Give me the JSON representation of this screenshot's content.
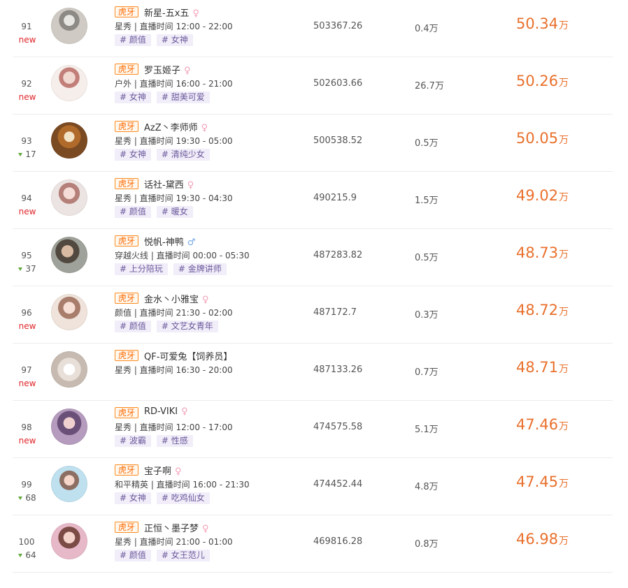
{
  "colors": {
    "platform_tag": "#ff6a00",
    "heat": "#e9702c",
    "new_badge": "#e0262a",
    "down_arrow": "#62a83a",
    "tag_bg": "#f1edf9",
    "tag_text": "#6b5a9c",
    "female_icon": "#f29fb6",
    "male_icon": "#73a8e6"
  },
  "rows": [
    {
      "rank": "91",
      "change": "new",
      "change_type": "new",
      "platform": "虎牙",
      "name": "新星-五x五",
      "gender": "female",
      "category": "星秀",
      "schedule": "星秀 | 直播时间 12:00 - 22:00",
      "tags": [
        "# 颜值",
        "# 女神"
      ],
      "score": "503367.26",
      "fans": "0.4万",
      "heat": "50.34",
      "heat_unit": "万"
    },
    {
      "rank": "92",
      "change": "new",
      "change_type": "new",
      "platform": "虎牙",
      "name": "罗玉姬子",
      "gender": "female",
      "schedule": "户外 | 直播时间 16:00 - 21:00",
      "tags": [
        "# 女神",
        "# 甜美可爱"
      ],
      "score": "502603.66",
      "fans": "26.7万",
      "heat": "50.26",
      "heat_unit": "万"
    },
    {
      "rank": "93",
      "change": "17",
      "change_type": "down",
      "platform": "虎牙",
      "name": "AzZ丶李师师",
      "gender": "female",
      "schedule": "星秀 | 直播时间 19:30 - 05:00",
      "tags": [
        "# 女神",
        "# 清纯少女"
      ],
      "score": "500538.52",
      "fans": "0.5万",
      "heat": "50.05",
      "heat_unit": "万"
    },
    {
      "rank": "94",
      "change": "new",
      "change_type": "new",
      "platform": "虎牙",
      "name": "话社-黛西",
      "gender": "female",
      "schedule": "星秀 | 直播时间 19:30 - 04:30",
      "tags": [
        "# 颜值",
        "# 暖女"
      ],
      "score": "490215.9",
      "fans": "1.5万",
      "heat": "49.02",
      "heat_unit": "万"
    },
    {
      "rank": "95",
      "change": "37",
      "change_type": "down",
      "platform": "虎牙",
      "name": "悦帆-神鸭",
      "gender": "male",
      "schedule": "穿越火线 | 直播时间 00:00 - 05:30",
      "tags": [
        "# 上分陪玩",
        "# 金牌讲师"
      ],
      "score": "487283.82",
      "fans": "0.5万",
      "heat": "48.73",
      "heat_unit": "万"
    },
    {
      "rank": "96",
      "change": "new",
      "change_type": "new",
      "platform": "虎牙",
      "name": "金水丶小雅宝",
      "gender": "female",
      "schedule": "颜值 | 直播时间 21:30 - 02:00",
      "tags": [
        "# 颜值",
        "# 文艺女青年"
      ],
      "score": "487172.7",
      "fans": "0.3万",
      "heat": "48.72",
      "heat_unit": "万"
    },
    {
      "rank": "97",
      "change": "new",
      "change_type": "new",
      "platform": "虎牙",
      "name": "QF-可爱兔【饲养员】",
      "gender": "",
      "schedule": "星秀 | 直播时间 16:30 - 20:00",
      "tags": [],
      "score": "487133.26",
      "fans": "0.7万",
      "heat": "48.71",
      "heat_unit": "万"
    },
    {
      "rank": "98",
      "change": "new",
      "change_type": "new",
      "platform": "虎牙",
      "name": "RD-VIKI",
      "gender": "female",
      "schedule": "星秀 | 直播时间 12:00 - 17:00",
      "tags": [
        "# 波霸",
        "# 性感"
      ],
      "score": "474575.58",
      "fans": "5.1万",
      "heat": "47.46",
      "heat_unit": "万"
    },
    {
      "rank": "99",
      "change": "68",
      "change_type": "down",
      "platform": "虎牙",
      "name": "宝子啊",
      "gender": "female",
      "schedule": "和平精英 | 直播时间 16:00 - 21:30",
      "tags": [
        "# 女神",
        "# 吃鸡仙女"
      ],
      "score": "474452.44",
      "fans": "4.8万",
      "heat": "47.45",
      "heat_unit": "万"
    },
    {
      "rank": "100",
      "change": "64",
      "change_type": "down",
      "platform": "虎牙",
      "name": "正恒丶墨子梦",
      "gender": "female",
      "schedule": "星秀 | 直播时间 21:00 - 01:00",
      "tags": [
        "# 颜值",
        "# 女王范儿"
      ],
      "score": "469816.28",
      "fans": "0.8万",
      "heat": "46.98",
      "heat_unit": "万"
    }
  ]
}
